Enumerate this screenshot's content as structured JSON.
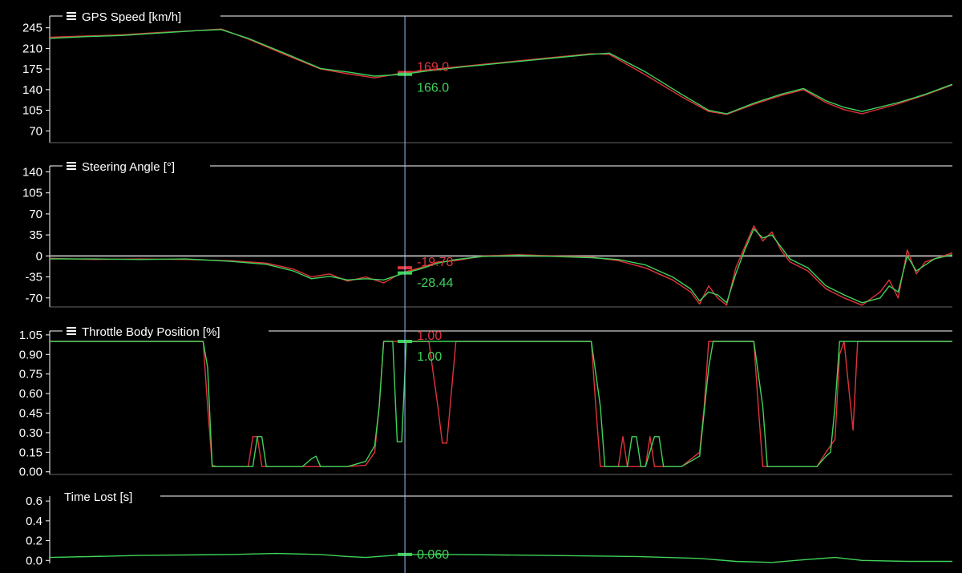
{
  "colors": {
    "background": "#000000",
    "axis": "#ffffff",
    "cursor": "#9fc3ff",
    "lap_red": "#e0343c",
    "lap_green": "#3fd35a",
    "zero_line": "#aaaaaa"
  },
  "menu_icon": "hamburger-menu-icon",
  "cursor_x": 0.3935,
  "chart_data": [
    {
      "type": "line",
      "title": "GPS Speed [km/h]",
      "ylim": [
        50,
        265
      ],
      "yticks": [
        "245",
        "210",
        "175",
        "140",
        "105",
        "70"
      ],
      "ytick_values": [
        245,
        210,
        175,
        140,
        105,
        70
      ],
      "cursor_labels": {
        "red": "169.0",
        "green": "166.0"
      },
      "cursor_values": {
        "red": 169.0,
        "green": 166.0
      },
      "series": [
        {
          "color": "red",
          "x": [
            0,
            0.04,
            0.08,
            0.12,
            0.16,
            0.19,
            0.22,
            0.26,
            0.3,
            0.33,
            0.36,
            0.39,
            0.42,
            0.46,
            0.5,
            0.54,
            0.58,
            0.6,
            0.62,
            0.66,
            0.7,
            0.73,
            0.75,
            0.78,
            0.81,
            0.835,
            0.86,
            0.88,
            0.9,
            0.94,
            0.97,
            1.0
          ],
          "y": [
            229,
            231,
            233,
            237,
            240,
            243,
            226,
            200,
            175,
            167,
            160,
            168,
            174,
            180,
            186,
            192,
            198,
            201,
            200,
            165,
            128,
            103,
            98,
            115,
            130,
            140,
            118,
            106,
            99,
            116,
            131,
            148
          ]
        },
        {
          "color": "green",
          "x": [
            0,
            0.04,
            0.08,
            0.12,
            0.16,
            0.19,
            0.22,
            0.26,
            0.3,
            0.33,
            0.36,
            0.39,
            0.42,
            0.46,
            0.5,
            0.54,
            0.58,
            0.6,
            0.62,
            0.66,
            0.7,
            0.73,
            0.75,
            0.78,
            0.81,
            0.835,
            0.86,
            0.88,
            0.9,
            0.94,
            0.97,
            1.0
          ],
          "y": [
            227,
            230,
            232,
            236,
            240,
            242,
            227,
            202,
            176,
            170,
            163,
            166,
            172,
            179,
            185,
            191,
            197,
            200,
            202,
            170,
            132,
            105,
            99,
            117,
            132,
            142,
            121,
            110,
            103,
            118,
            132,
            149
          ]
        }
      ]
    },
    {
      "type": "line",
      "title": "Steering Angle [°]",
      "ylim": [
        -85,
        150
      ],
      "yticks": [
        "140",
        "105",
        "70",
        "35",
        "0",
        "-35",
        "-70"
      ],
      "ytick_values": [
        140,
        105,
        70,
        35,
        0,
        -35,
        -70
      ],
      "zero_line": true,
      "cursor_labels": {
        "red": "-19.78",
        "green": "-28.44"
      },
      "cursor_values": {
        "red": -19.78,
        "green": -28.44
      },
      "series": [
        {
          "color": "red",
          "x": [
            0,
            0.05,
            0.1,
            0.15,
            0.2,
            0.24,
            0.27,
            0.29,
            0.31,
            0.33,
            0.35,
            0.37,
            0.39,
            0.41,
            0.43,
            0.45,
            0.48,
            0.52,
            0.56,
            0.6,
            0.63,
            0.66,
            0.69,
            0.71,
            0.72,
            0.73,
            0.74,
            0.75,
            0.76,
            0.77,
            0.78,
            0.79,
            0.8,
            0.81,
            0.82,
            0.84,
            0.86,
            0.88,
            0.9,
            0.92,
            0.93,
            0.94,
            0.95,
            0.96,
            0.97,
            0.98,
            1.0
          ],
          "y": [
            -4,
            -6,
            -5,
            -6,
            -8,
            -12,
            -22,
            -35,
            -30,
            -42,
            -35,
            -45,
            -28,
            -20,
            -10,
            -8,
            0,
            2,
            0,
            -2,
            -8,
            -20,
            -40,
            -60,
            -80,
            -50,
            -70,
            -82,
            -20,
            15,
            50,
            25,
            40,
            10,
            -10,
            -25,
            -55,
            -70,
            -82,
            -60,
            -40,
            -70,
            10,
            -30,
            -10,
            -5,
            5
          ]
        },
        {
          "color": "green",
          "x": [
            0,
            0.05,
            0.1,
            0.15,
            0.2,
            0.24,
            0.27,
            0.29,
            0.31,
            0.33,
            0.35,
            0.37,
            0.39,
            0.41,
            0.43,
            0.45,
            0.48,
            0.52,
            0.56,
            0.6,
            0.63,
            0.66,
            0.69,
            0.71,
            0.72,
            0.73,
            0.74,
            0.75,
            0.76,
            0.77,
            0.78,
            0.79,
            0.8,
            0.81,
            0.82,
            0.84,
            0.86,
            0.88,
            0.9,
            0.92,
            0.93,
            0.94,
            0.95,
            0.96,
            0.97,
            0.98,
            1.0
          ],
          "y": [
            -5,
            -5,
            -6,
            -5,
            -9,
            -14,
            -25,
            -38,
            -34,
            -40,
            -38,
            -40,
            -30,
            -22,
            -12,
            -6,
            -1,
            1,
            -1,
            -3,
            -6,
            -15,
            -35,
            -55,
            -75,
            -60,
            -65,
            -78,
            -30,
            10,
            45,
            30,
            35,
            15,
            -5,
            -20,
            -50,
            -65,
            -78,
            -70,
            -50,
            -60,
            0,
            -25,
            -15,
            -5,
            2
          ]
        }
      ]
    },
    {
      "type": "line",
      "title": "Throttle Body Position [%]",
      "ylim": [
        -0.02,
        1.08
      ],
      "yticks": [
        "1.05",
        "0.90",
        "0.75",
        "0.60",
        "0.45",
        "0.30",
        "0.15",
        "0.00"
      ],
      "ytick_values": [
        1.05,
        0.9,
        0.75,
        0.6,
        0.45,
        0.3,
        0.15,
        0.0
      ],
      "cursor_labels": {
        "red": "1.00",
        "green": "1.00"
      },
      "cursor_values": {
        "red": 1.0,
        "green": 1.0
      },
      "series": [
        {
          "color": "red",
          "x": [
            0,
            0.17,
            0.175,
            0.18,
            0.185,
            0.2,
            0.22,
            0.225,
            0.23,
            0.235,
            0.3,
            0.33,
            0.35,
            0.36,
            0.365,
            0.37,
            0.375,
            0.38,
            0.395,
            0.4,
            0.41,
            0.42,
            0.43,
            0.435,
            0.44,
            0.45,
            0.6,
            0.605,
            0.61,
            0.615,
            0.63,
            0.635,
            0.64,
            0.645,
            0.66,
            0.665,
            0.67,
            0.675,
            0.7,
            0.72,
            0.725,
            0.73,
            0.74,
            0.78,
            0.785,
            0.79,
            0.8,
            0.85,
            0.86,
            0.87,
            0.875,
            0.88,
            0.89,
            0.895,
            0.9,
            1.0
          ],
          "y": [
            1,
            1,
            0.5,
            0.05,
            0.04,
            0.04,
            0.04,
            0.27,
            0.27,
            0.04,
            0.04,
            0.04,
            0.05,
            0.15,
            0.5,
            1,
            1,
            1,
            1,
            1,
            1,
            1,
            0.5,
            0.22,
            0.22,
            1,
            1,
            0.5,
            0.04,
            0.04,
            0.04,
            0.27,
            0.04,
            0.04,
            0.04,
            0.27,
            0.04,
            0.04,
            0.04,
            0.15,
            0.5,
            1,
            1,
            1,
            0.5,
            0.04,
            0.04,
            0.04,
            0.15,
            0.25,
            0.9,
            1,
            0.32,
            1,
            1,
            1
          ]
        },
        {
          "color": "green",
          "x": [
            0,
            0.17,
            0.175,
            0.18,
            0.185,
            0.2,
            0.225,
            0.23,
            0.235,
            0.24,
            0.28,
            0.29,
            0.295,
            0.3,
            0.33,
            0.35,
            0.36,
            0.365,
            0.37,
            0.375,
            0.38,
            0.385,
            0.39,
            0.395,
            0.4,
            0.41,
            0.42,
            0.43,
            0.435,
            0.44,
            0.45,
            0.6,
            0.61,
            0.615,
            0.62,
            0.64,
            0.645,
            0.65,
            0.655,
            0.66,
            0.67,
            0.675,
            0.68,
            0.69,
            0.7,
            0.72,
            0.73,
            0.735,
            0.74,
            0.78,
            0.79,
            0.795,
            0.8,
            0.85,
            0.86,
            0.865,
            0.87,
            0.875,
            0.88,
            0.89,
            1.0
          ],
          "y": [
            1,
            1,
            0.8,
            0.04,
            0.04,
            0.04,
            0.04,
            0.27,
            0.27,
            0.04,
            0.04,
            0.1,
            0.12,
            0.04,
            0.04,
            0.08,
            0.2,
            0.5,
            1,
            1,
            1,
            0.23,
            0.23,
            1,
            1,
            1,
            1,
            1,
            1,
            1,
            1,
            1,
            0.5,
            0.04,
            0.04,
            0.04,
            0.27,
            0.27,
            0.04,
            0.04,
            0.27,
            0.27,
            0.04,
            0.04,
            0.04,
            0.12,
            0.8,
            1,
            1,
            1,
            0.5,
            0.04,
            0.04,
            0.04,
            0.12,
            0.15,
            0.5,
            1,
            1,
            1,
            1
          ]
        }
      ]
    },
    {
      "type": "line",
      "title": "Time Lost [s]",
      "ylim": [
        -0.03,
        0.65
      ],
      "yticks": [
        "0.6",
        "0.4",
        "0.2",
        "0.0"
      ],
      "ytick_values": [
        0.6,
        0.4,
        0.2,
        0.0
      ],
      "cursor_labels": {
        "green": "0.060"
      },
      "cursor_values": {
        "green": 0.06
      },
      "series": [
        {
          "color": "green",
          "x": [
            0,
            0.1,
            0.2,
            0.25,
            0.3,
            0.33,
            0.35,
            0.3935,
            0.45,
            0.55,
            0.65,
            0.72,
            0.76,
            0.8,
            0.84,
            0.87,
            0.9,
            0.95,
            1.0
          ],
          "y": [
            0.03,
            0.05,
            0.06,
            0.07,
            0.06,
            0.04,
            0.03,
            0.06,
            0.06,
            0.05,
            0.04,
            0.02,
            -0.01,
            -0.02,
            0.01,
            0.03,
            0.0,
            -0.01,
            -0.01
          ]
        }
      ]
    }
  ]
}
